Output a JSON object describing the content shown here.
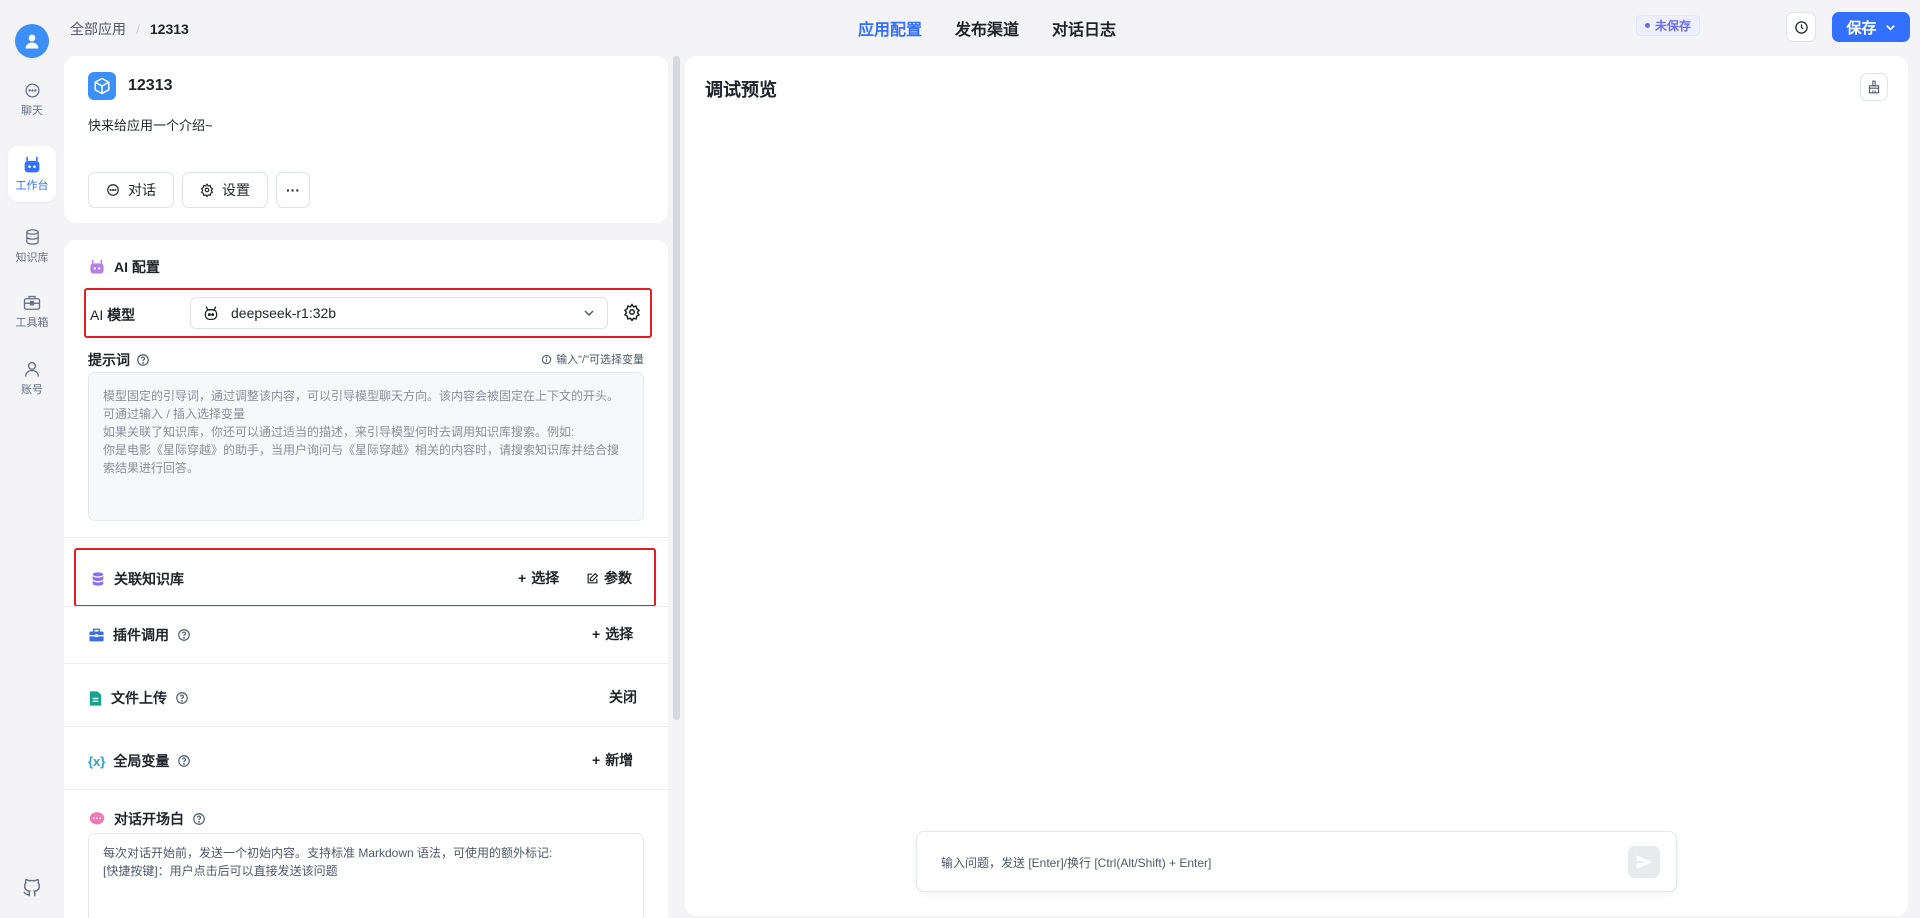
{
  "nav": {
    "items": [
      {
        "label": "聊天",
        "icon": "chat-icon"
      },
      {
        "label": "工作台",
        "icon": "robot-icon"
      },
      {
        "label": "知识库",
        "icon": "database-icon"
      },
      {
        "label": "工具箱",
        "icon": "toolbox-icon"
      },
      {
        "label": "账号",
        "icon": "user-icon"
      }
    ],
    "active": "工作台"
  },
  "topbar": {
    "breadcrumb": {
      "root": "全部应用",
      "sep": "/",
      "current": "12313"
    },
    "tabs": [
      "应用配置",
      "发布渠道",
      "对话日志"
    ],
    "active_tab": "应用配置",
    "status": "未保存",
    "save_label": "保存"
  },
  "app": {
    "name": "12313",
    "intro": "快来给应用一个介绍~",
    "buttons": {
      "chat": "对话",
      "settings": "设置",
      "more": "···"
    }
  },
  "config": {
    "ai_title": "AI 配置",
    "model_label_prefix": "AI",
    "model_label_main": "模型",
    "model_value": "deepseek-r1:32b",
    "prompt_label": "提示词",
    "prompt_hint": "输入\"/\"可选择变量",
    "prompt_placeholder": "模型固定的引导词，通过调整该内容，可以引导模型聊天方向。该内容会被固定在上下文的开头。可通过输入 / 插入选择变量\n如果关联了知识库，你还可以通过适当的描述，来引导模型何时去调用知识库搜索。例如:\n你是电影《星际穿越》的助手，当用户询问与《星际穿越》相关的内容时，请搜索知识库并结合搜索结果进行回答。",
    "kb_title": "关联知识库",
    "kb_select": "选择",
    "kb_params": "参数",
    "plugin_title": "插件调用",
    "plugin_select": "选择",
    "file_title": "文件上传",
    "file_state": "关闭",
    "var_title": "全局变量",
    "var_add": "新增",
    "greeting_title": "对话开场白",
    "greeting_placeholder": "每次对话开始前，发送一个初始内容。支持标准 Markdown 语法，可使用的额外标记:\n[快捷按键]：用户点击后可以直接发送该问题"
  },
  "preview": {
    "title": "调试预览",
    "input_placeholder": "输入问题，发送 [Enter]/换行 [Ctrl(Alt/Shift) + Enter]"
  },
  "colors": {
    "accent": "#3370ff",
    "highlight": "#e02020",
    "bg": "#f4f4f7"
  }
}
